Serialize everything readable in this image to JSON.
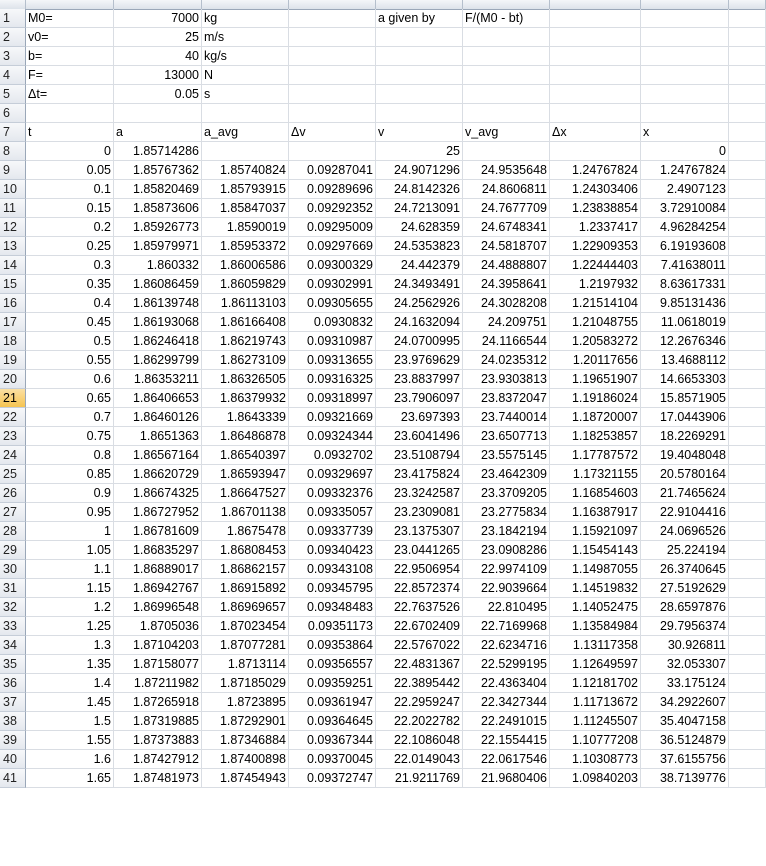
{
  "params": [
    {
      "row": "1",
      "label": "M0=",
      "value": "7000",
      "unit": "kg",
      "e": "a given by",
      "f": "F/(M0 - bt)"
    },
    {
      "row": "2",
      "label": "v0=",
      "value": "25",
      "unit": "m/s",
      "e": "",
      "f": ""
    },
    {
      "row": "3",
      "label": "b=",
      "value": "40",
      "unit": "kg/s",
      "e": "",
      "f": ""
    },
    {
      "row": "4",
      "label": "F=",
      "value": "13000",
      "unit": "N",
      "e": "",
      "f": ""
    },
    {
      "row": "5",
      "label": "Δt=",
      "value": "0.05",
      "unit": "s",
      "e": "",
      "f": ""
    }
  ],
  "blank_row": "6",
  "header_row": {
    "row": "7",
    "cols": [
      "t",
      "a",
      "a_avg",
      "Δv",
      "v",
      "v_avg",
      "Δx",
      "x"
    ]
  },
  "selected_row": "21",
  "data_rows": [
    {
      "row": "8",
      "cells": [
        "0",
        "1.85714286",
        "",
        "",
        "25",
        "",
        "",
        "0"
      ]
    },
    {
      "row": "9",
      "cells": [
        "0.05",
        "1.85767362",
        "1.85740824",
        "0.09287041",
        "24.9071296",
        "24.9535648",
        "1.24767824",
        "1.24767824"
      ]
    },
    {
      "row": "10",
      "cells": [
        "0.1",
        "1.85820469",
        "1.85793915",
        "0.09289696",
        "24.8142326",
        "24.8606811",
        "1.24303406",
        "2.4907123"
      ]
    },
    {
      "row": "11",
      "cells": [
        "0.15",
        "1.85873606",
        "1.85847037",
        "0.09292352",
        "24.7213091",
        "24.7677709",
        "1.23838854",
        "3.72910084"
      ]
    },
    {
      "row": "12",
      "cells": [
        "0.2",
        "1.85926773",
        "1.8590019",
        "0.09295009",
        "24.628359",
        "24.6748341",
        "1.2337417",
        "4.96284254"
      ]
    },
    {
      "row": "13",
      "cells": [
        "0.25",
        "1.85979971",
        "1.85953372",
        "0.09297669",
        "24.5353823",
        "24.5818707",
        "1.22909353",
        "6.19193608"
      ]
    },
    {
      "row": "14",
      "cells": [
        "0.3",
        "1.860332",
        "1.86006586",
        "0.09300329",
        "24.442379",
        "24.4888807",
        "1.22444403",
        "7.41638011"
      ]
    },
    {
      "row": "15",
      "cells": [
        "0.35",
        "1.86086459",
        "1.86059829",
        "0.09302991",
        "24.3493491",
        "24.3958641",
        "1.2197932",
        "8.63617331"
      ]
    },
    {
      "row": "16",
      "cells": [
        "0.4",
        "1.86139748",
        "1.86113103",
        "0.09305655",
        "24.2562926",
        "24.3028208",
        "1.21514104",
        "9.85131436"
      ]
    },
    {
      "row": "17",
      "cells": [
        "0.45",
        "1.86193068",
        "1.86166408",
        "0.0930832",
        "24.1632094",
        "24.209751",
        "1.21048755",
        "11.0618019"
      ]
    },
    {
      "row": "18",
      "cells": [
        "0.5",
        "1.86246418",
        "1.86219743",
        "0.09310987",
        "24.0700995",
        "24.1166544",
        "1.20583272",
        "12.2676346"
      ]
    },
    {
      "row": "19",
      "cells": [
        "0.55",
        "1.86299799",
        "1.86273109",
        "0.09313655",
        "23.9769629",
        "24.0235312",
        "1.20117656",
        "13.4688112"
      ]
    },
    {
      "row": "20",
      "cells": [
        "0.6",
        "1.86353211",
        "1.86326505",
        "0.09316325",
        "23.8837997",
        "23.9303813",
        "1.19651907",
        "14.6653303"
      ]
    },
    {
      "row": "21",
      "cells": [
        "0.65",
        "1.86406653",
        "1.86379932",
        "0.09318997",
        "23.7906097",
        "23.8372047",
        "1.19186024",
        "15.8571905"
      ]
    },
    {
      "row": "22",
      "cells": [
        "0.7",
        "1.86460126",
        "1.8643339",
        "0.09321669",
        "23.697393",
        "23.7440014",
        "1.18720007",
        "17.0443906"
      ]
    },
    {
      "row": "23",
      "cells": [
        "0.75",
        "1.8651363",
        "1.86486878",
        "0.09324344",
        "23.6041496",
        "23.6507713",
        "1.18253857",
        "18.2269291"
      ]
    },
    {
      "row": "24",
      "cells": [
        "0.8",
        "1.86567164",
        "1.86540397",
        "0.0932702",
        "23.5108794",
        "23.5575145",
        "1.17787572",
        "19.4048048"
      ]
    },
    {
      "row": "25",
      "cells": [
        "0.85",
        "1.86620729",
        "1.86593947",
        "0.09329697",
        "23.4175824",
        "23.4642309",
        "1.17321155",
        "20.5780164"
      ]
    },
    {
      "row": "26",
      "cells": [
        "0.9",
        "1.86674325",
        "1.86647527",
        "0.09332376",
        "23.3242587",
        "23.3709205",
        "1.16854603",
        "21.7465624"
      ]
    },
    {
      "row": "27",
      "cells": [
        "0.95",
        "1.86727952",
        "1.86701138",
        "0.09335057",
        "23.2309081",
        "23.2775834",
        "1.16387917",
        "22.9104416"
      ]
    },
    {
      "row": "28",
      "cells": [
        "1",
        "1.86781609",
        "1.8675478",
        "0.09337739",
        "23.1375307",
        "23.1842194",
        "1.15921097",
        "24.0696526"
      ]
    },
    {
      "row": "29",
      "cells": [
        "1.05",
        "1.86835297",
        "1.86808453",
        "0.09340423",
        "23.0441265",
        "23.0908286",
        "1.15454143",
        "25.224194"
      ]
    },
    {
      "row": "30",
      "cells": [
        "1.1",
        "1.86889017",
        "1.86862157",
        "0.09343108",
        "22.9506954",
        "22.9974109",
        "1.14987055",
        "26.3740645"
      ]
    },
    {
      "row": "31",
      "cells": [
        "1.15",
        "1.86942767",
        "1.86915892",
        "0.09345795",
        "22.8572374",
        "22.9039664",
        "1.14519832",
        "27.5192629"
      ]
    },
    {
      "row": "32",
      "cells": [
        "1.2",
        "1.86996548",
        "1.86969657",
        "0.09348483",
        "22.7637526",
        "22.810495",
        "1.14052475",
        "28.6597876"
      ]
    },
    {
      "row": "33",
      "cells": [
        "1.25",
        "1.8705036",
        "1.87023454",
        "0.09351173",
        "22.6702409",
        "22.7169968",
        "1.13584984",
        "29.7956374"
      ]
    },
    {
      "row": "34",
      "cells": [
        "1.3",
        "1.87104203",
        "1.87077281",
        "0.09353864",
        "22.5767022",
        "22.6234716",
        "1.13117358",
        "30.926811"
      ]
    },
    {
      "row": "35",
      "cells": [
        "1.35",
        "1.87158077",
        "1.8713114",
        "0.09356557",
        "22.4831367",
        "22.5299195",
        "1.12649597",
        "32.053307"
      ]
    },
    {
      "row": "36",
      "cells": [
        "1.4",
        "1.87211982",
        "1.87185029",
        "0.09359251",
        "22.3895442",
        "22.4363404",
        "1.12181702",
        "33.175124"
      ]
    },
    {
      "row": "37",
      "cells": [
        "1.45",
        "1.87265918",
        "1.8723895",
        "0.09361947",
        "22.2959247",
        "22.3427344",
        "1.11713672",
        "34.2922607"
      ]
    },
    {
      "row": "38",
      "cells": [
        "1.5",
        "1.87319885",
        "1.87292901",
        "0.09364645",
        "22.2022782",
        "22.2491015",
        "1.11245507",
        "35.4047158"
      ]
    },
    {
      "row": "39",
      "cells": [
        "1.55",
        "1.87373883",
        "1.87346884",
        "0.09367344",
        "22.1086048",
        "22.1554415",
        "1.10777208",
        "36.5124879"
      ]
    },
    {
      "row": "40",
      "cells": [
        "1.6",
        "1.87427912",
        "1.87400898",
        "0.09370045",
        "22.0149043",
        "22.0617546",
        "1.10308773",
        "37.6155756"
      ]
    },
    {
      "row": "41",
      "cells": [
        "1.65",
        "1.87481973",
        "1.87454943",
        "0.09372747",
        "21.9211769",
        "21.9680406",
        "1.09840203",
        "38.7139776"
      ]
    }
  ]
}
